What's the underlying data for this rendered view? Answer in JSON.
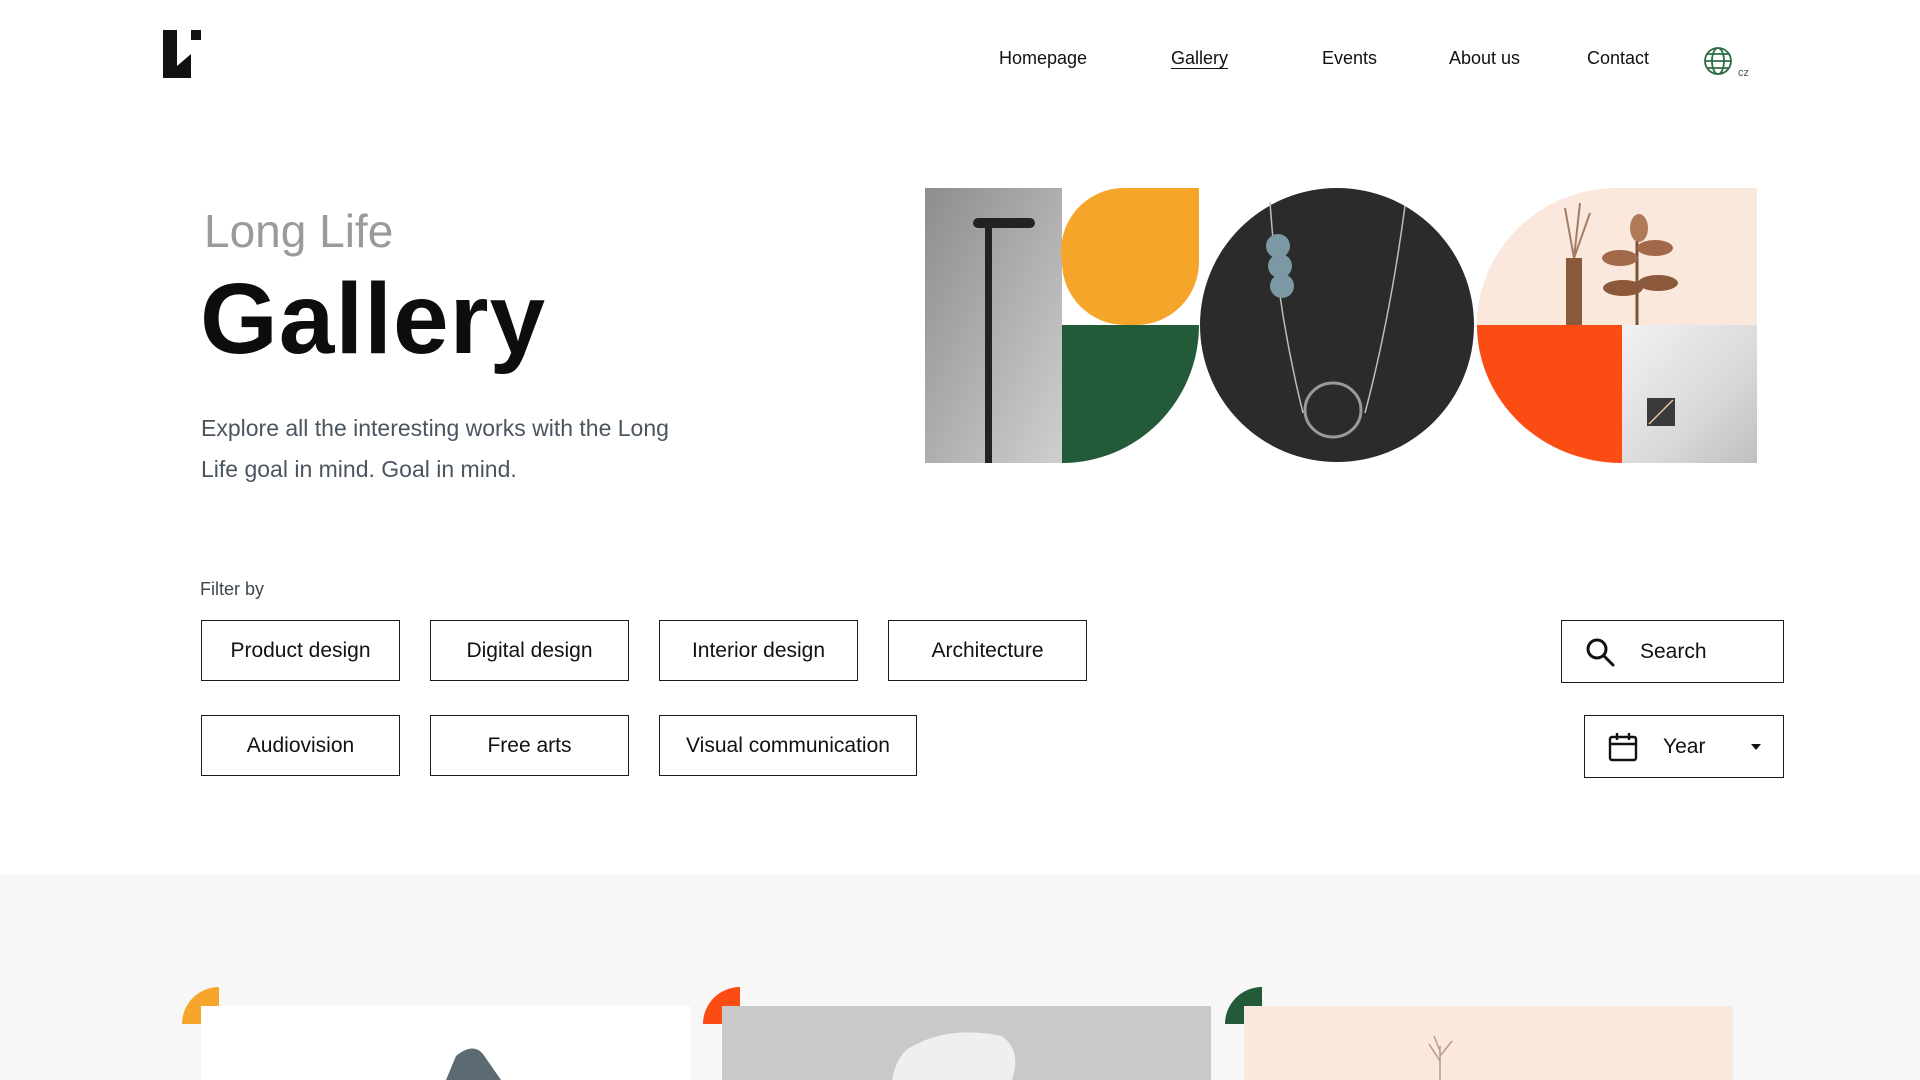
{
  "header": {
    "logo_label": "Long Life logo",
    "nav": [
      {
        "label": "Homepage",
        "active": false
      },
      {
        "label": "Gallery",
        "active": true
      },
      {
        "label": "Events",
        "active": false
      },
      {
        "label": "About us",
        "active": false
      },
      {
        "label": "Contact",
        "active": false
      }
    ],
    "language_icon": "globe-icon",
    "language": "cz"
  },
  "hero": {
    "eyebrow": "Long Life",
    "title": "Gallery",
    "description": "Explore all the interesting works with the Long Life goal in mind. Goal in mind."
  },
  "filters": {
    "label": "Filter by",
    "categories": [
      "Product design",
      "Digital design",
      "Interior design",
      "Architecture",
      "Audiovision",
      "Free arts",
      "Visual communication"
    ],
    "search": {
      "icon": "search-icon",
      "label": "Search"
    },
    "year": {
      "icon": "calendar-icon",
      "label": "Year",
      "dropdown_icon": "caret-down-icon"
    }
  },
  "colors": {
    "orange": "#f6a52b",
    "green": "#235a37",
    "red_orange": "#fb4c14",
    "peach": "#fbe8dc",
    "charcoal": "#2b2b2b",
    "band": "#f7f7f7"
  }
}
